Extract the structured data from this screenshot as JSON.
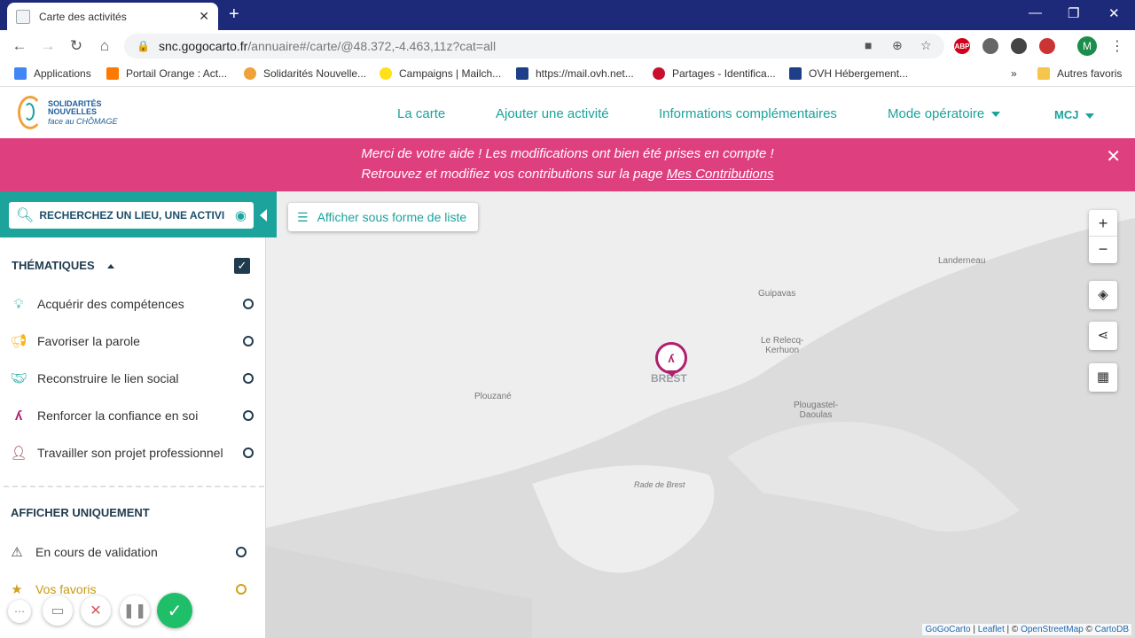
{
  "browser": {
    "tab_title": "Carte des activités",
    "url_host": "snc.gogocarto.fr",
    "url_path": "/annuaire#/carte/@48.372,-4.463,11z?cat=all",
    "avatar_letter": "M",
    "ext_abp": "ABP"
  },
  "bookmarks": {
    "items": [
      "Applications",
      "Portail Orange : Act...",
      "Solidarités Nouvelle...",
      "Campaigns | Mailch...",
      "https://mail.ovh.net...",
      "Partages - Identifica...",
      "OVH Hébergement..."
    ],
    "more": "»",
    "other": "Autres favoris"
  },
  "site": {
    "logo_line1": "SOLIDARITÉS",
    "logo_line2": "NOUVELLES",
    "logo_line3": "face au CHÔMAGE",
    "nav": {
      "map": "La carte",
      "add": "Ajouter une activité",
      "info": "Informations complémentaires",
      "mode": "Mode opératoire",
      "user": "MCJ"
    }
  },
  "banner": {
    "line1": "Merci de votre aide ! Les modifications ont bien été prises en compte !",
    "line2_prefix": "Retrouvez et modifiez vos contributions sur la page ",
    "line2_link": "Mes Contributions"
  },
  "sidebar": {
    "search_placeholder": "RECHERCHEZ UN LIEU, UNE ACTIVI",
    "thematiques_title": "THÉMATIQUES",
    "categories": [
      {
        "label": "Acquérir des compétences",
        "icon": "lightbulb-icon"
      },
      {
        "label": "Favoriser la parole",
        "icon": "megaphone-icon"
      },
      {
        "label": "Reconstruire le lien social",
        "icon": "handshake-icon"
      },
      {
        "label": "Renforcer la confiance en soi",
        "icon": "confidence-icon"
      },
      {
        "label": "Travailler son projet professionnel",
        "icon": "user-plus-icon"
      }
    ],
    "afficher_title": "AFFICHER UNIQUEMENT",
    "filters": [
      {
        "label": "En cours de validation",
        "icon": "warning-icon"
      },
      {
        "label": "Vos favoris",
        "icon": "star-icon"
      }
    ]
  },
  "map": {
    "list_button": "Afficher sous forme de liste",
    "labels": {
      "landerneau": "Landerneau",
      "guipavas": "Guipavas",
      "relecq1": "Le Relecq-",
      "relecq2": "Kerhuon",
      "brest": "BREST",
      "plouzane": "Plouzané",
      "plougastel1": "Plougastel-",
      "plougastel2": "Daoulas",
      "rade": "Rade de Brest"
    },
    "attribution": {
      "gogocarto": "GoGoCarto",
      "sep1": " | ",
      "leaflet": "Leaflet",
      "sep2": " | © ",
      "osm": "OpenStreetMap",
      "sep3": " © ",
      "carto": "CartoDB"
    }
  },
  "colors": {
    "brand": "#1ba39c",
    "banner": "#de3f7f",
    "marker": "#b01f6c",
    "dark": "#1f3b4d"
  }
}
